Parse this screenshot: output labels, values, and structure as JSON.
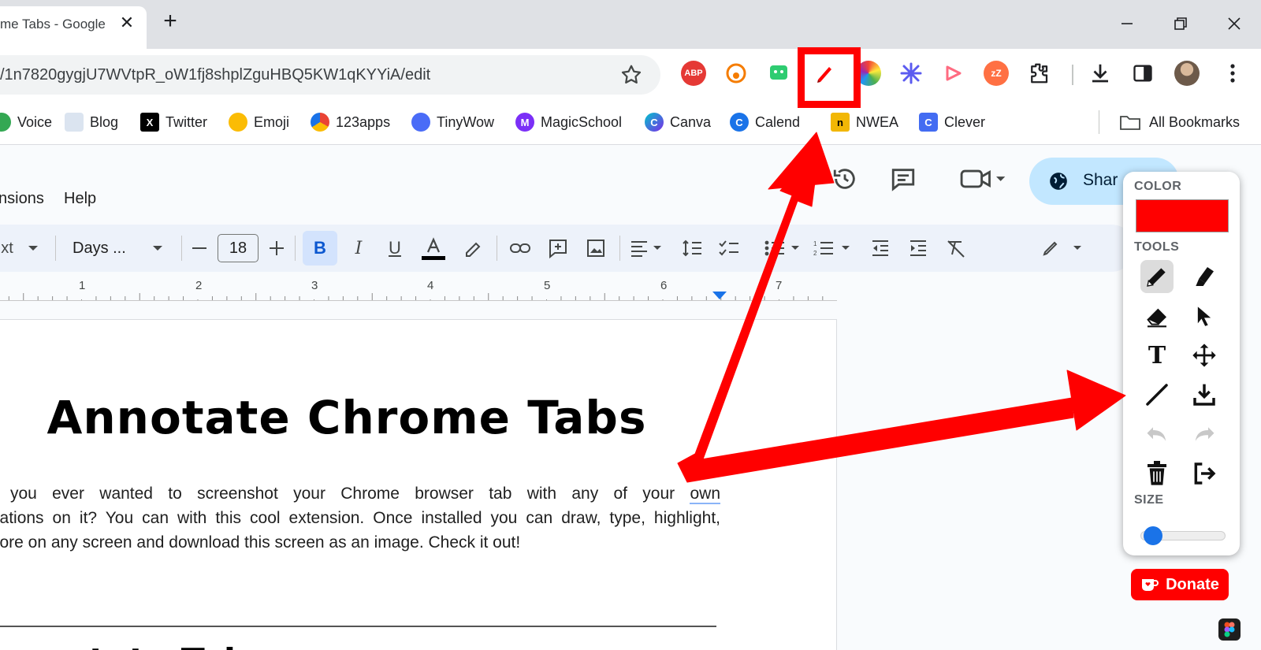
{
  "browser": {
    "tab_title": "me Tabs - Google",
    "tab_close": "✕",
    "new_tab": "+",
    "url": "/1n7820gygjU7WVtpR_oW1fj8shplZguHBQ5KW1qKYYiA/edit",
    "extension_icons": [
      "adblock-plus-icon",
      "honey-icon",
      "screen-capture-icon",
      "annotate-pen-icon",
      "color-picker-icon",
      "ai-star-icon",
      "screencast-icon",
      "snooze-icon",
      "extensions-puzzle-icon"
    ],
    "abp_label": "ABP",
    "zz_label": "zZ"
  },
  "bookmarks": [
    {
      "label": "Voice",
      "color": "#34a853"
    },
    {
      "label": "Blog",
      "color": "#dbe4f0"
    },
    {
      "label": "Twitter",
      "color": "#000000"
    },
    {
      "label": "Emoji",
      "color": "#fbbc04"
    },
    {
      "label": "123apps",
      "color": "#ea4335"
    },
    {
      "label": "TinyWow",
      "color": "#4a6cf7"
    },
    {
      "label": "MagicSchool",
      "color": "#7b2ff7"
    },
    {
      "label": "Canva",
      "color": "#00c4cc"
    },
    {
      "label": "Calend",
      "color": "#1a73e8"
    },
    {
      "label": "NWEA",
      "color": "#f2b705"
    },
    {
      "label": "Clever",
      "color": "#436cf2"
    }
  ],
  "all_bookmarks": "All Bookmarks",
  "docs": {
    "menu": [
      "nsions",
      "Help"
    ],
    "share_label": "Shar",
    "font_name": "Days ...",
    "font_style": "xt",
    "font_size": "18",
    "ruler_numbers": [
      "1",
      "2",
      "3",
      "4",
      "5",
      "6",
      "7"
    ]
  },
  "document": {
    "title": "Annotate Chrome Tabs",
    "paragraph_lines": [
      "e you ever wanted to screenshot your Chrome browser tab with any of your",
      "otations on it? You can with this cool extension. Once installed you can draw, type, highlight,",
      " more on any screen and download this screen as an image. Check it out!"
    ],
    "paragraph_underlined_word": "own",
    "subheading": "nnotate Tab"
  },
  "annotate_panel": {
    "color_label": "COLOR",
    "selected_color": "#ff0000",
    "tools_label": "TOOLS",
    "tools": [
      "pen-icon",
      "highlighter-icon",
      "eraser-icon",
      "pointer-icon",
      "text-icon",
      "move-icon",
      "line-icon",
      "download-icon",
      "undo-icon",
      "redo-icon",
      "trash-icon",
      "exit-icon"
    ],
    "size_label": "SIZE",
    "size_value": 0.1,
    "donate_label": "Donate"
  },
  "colors": {
    "annotation_red": "#ff0000",
    "share_blue": "#c2e7ff",
    "accent_blue": "#1a73e8"
  }
}
